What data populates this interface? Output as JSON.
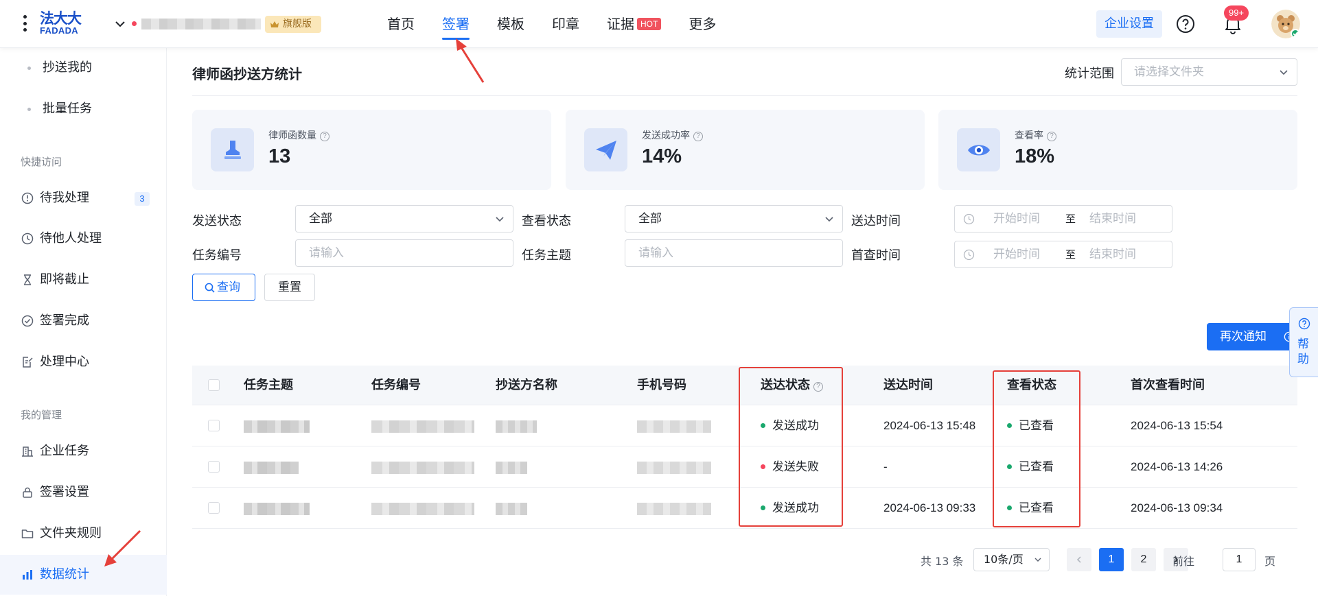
{
  "header": {
    "logo_cn": "法大大",
    "logo_en": "FADADA",
    "edition_badge": "旗舰版",
    "nav": [
      {
        "label": "首页"
      },
      {
        "label": "签署"
      },
      {
        "label": "模板"
      },
      {
        "label": "印章"
      },
      {
        "label": "证据",
        "badge": "HOT"
      },
      {
        "label": "更多"
      }
    ],
    "active_nav": "签署",
    "enterprise_settings": "企业设置",
    "notification_count": "99+"
  },
  "sidebar": {
    "sub_items": [
      {
        "label": "抄送我的"
      },
      {
        "label": "批量任务"
      }
    ],
    "quick_access_title": "快捷访问",
    "quick_access": [
      {
        "label": "待我处理",
        "count": "3",
        "icon": "clock-alert-icon"
      },
      {
        "label": "待他人处理",
        "icon": "clock-icon"
      },
      {
        "label": "即将截止",
        "icon": "hourglass-icon"
      },
      {
        "label": "签署完成",
        "icon": "check-circle-icon"
      },
      {
        "label": "处理中心",
        "icon": "edit-doc-icon"
      }
    ],
    "management_title": "我的管理",
    "management": [
      {
        "label": "企业任务",
        "icon": "building-icon"
      },
      {
        "label": "签署设置",
        "icon": "lock-icon"
      },
      {
        "label": "文件夹规则",
        "icon": "folder-icon"
      },
      {
        "label": "数据统计",
        "icon": "bar-chart-icon",
        "active": true
      }
    ]
  },
  "page": {
    "title": "律师函抄送方统计",
    "scope_label": "统计范围",
    "scope_placeholder": "请选择文件夹"
  },
  "stats": [
    {
      "label": "律师函数量",
      "value": "13",
      "icon": "stamp-icon"
    },
    {
      "label": "发送成功率",
      "value": "14%",
      "icon": "paper-plane-icon"
    },
    {
      "label": "查看率",
      "value": "18%",
      "icon": "eye-icon"
    }
  ],
  "filters": {
    "send_status_label": "发送状态",
    "send_status_value": "全部",
    "view_status_label": "查看状态",
    "view_status_value": "全部",
    "delivery_time_label": "送达时间",
    "task_no_label": "任务编号",
    "task_no_placeholder": "请输入",
    "task_subject_label": "任务主题",
    "task_subject_placeholder": "请输入",
    "first_view_label": "首查时间",
    "range_start": "开始时间",
    "range_sep": "至",
    "range_end": "结束时间",
    "query_button": "查询",
    "reset_button": "重置"
  },
  "renotify_button": "再次通知",
  "table": {
    "columns": [
      "任务主题",
      "任务编号",
      "抄送方名称",
      "手机号码",
      "送达状态",
      "送达时间",
      "查看状态",
      "首次查看时间"
    ],
    "rows": [
      {
        "send_status": "发送成功",
        "send_ok": true,
        "delivered_at": "2024-06-13 15:48",
        "view_status": "已查看",
        "first_viewed_at": "2024-06-13 15:54"
      },
      {
        "send_status": "发送失败",
        "send_ok": false,
        "delivered_at": "-",
        "view_status": "已查看",
        "first_viewed_at": "2024-06-13 14:26"
      },
      {
        "send_status": "发送成功",
        "send_ok": true,
        "delivered_at": "2024-06-13 09:33",
        "view_status": "已查看",
        "first_viewed_at": "2024-06-13 09:34"
      }
    ]
  },
  "pagination": {
    "total": "共 13 条",
    "page_size": "10条/页",
    "pages": [
      "1",
      "2"
    ],
    "current_page": "1",
    "goto_label": "前往",
    "goto_value": "1",
    "page_unit": "页"
  },
  "help_dock": {
    "label": "帮助"
  },
  "colors": {
    "primary": "#1b6ef3",
    "success": "#1aa86d",
    "danger": "#f5465d",
    "highlight_box": "#e5403a"
  }
}
